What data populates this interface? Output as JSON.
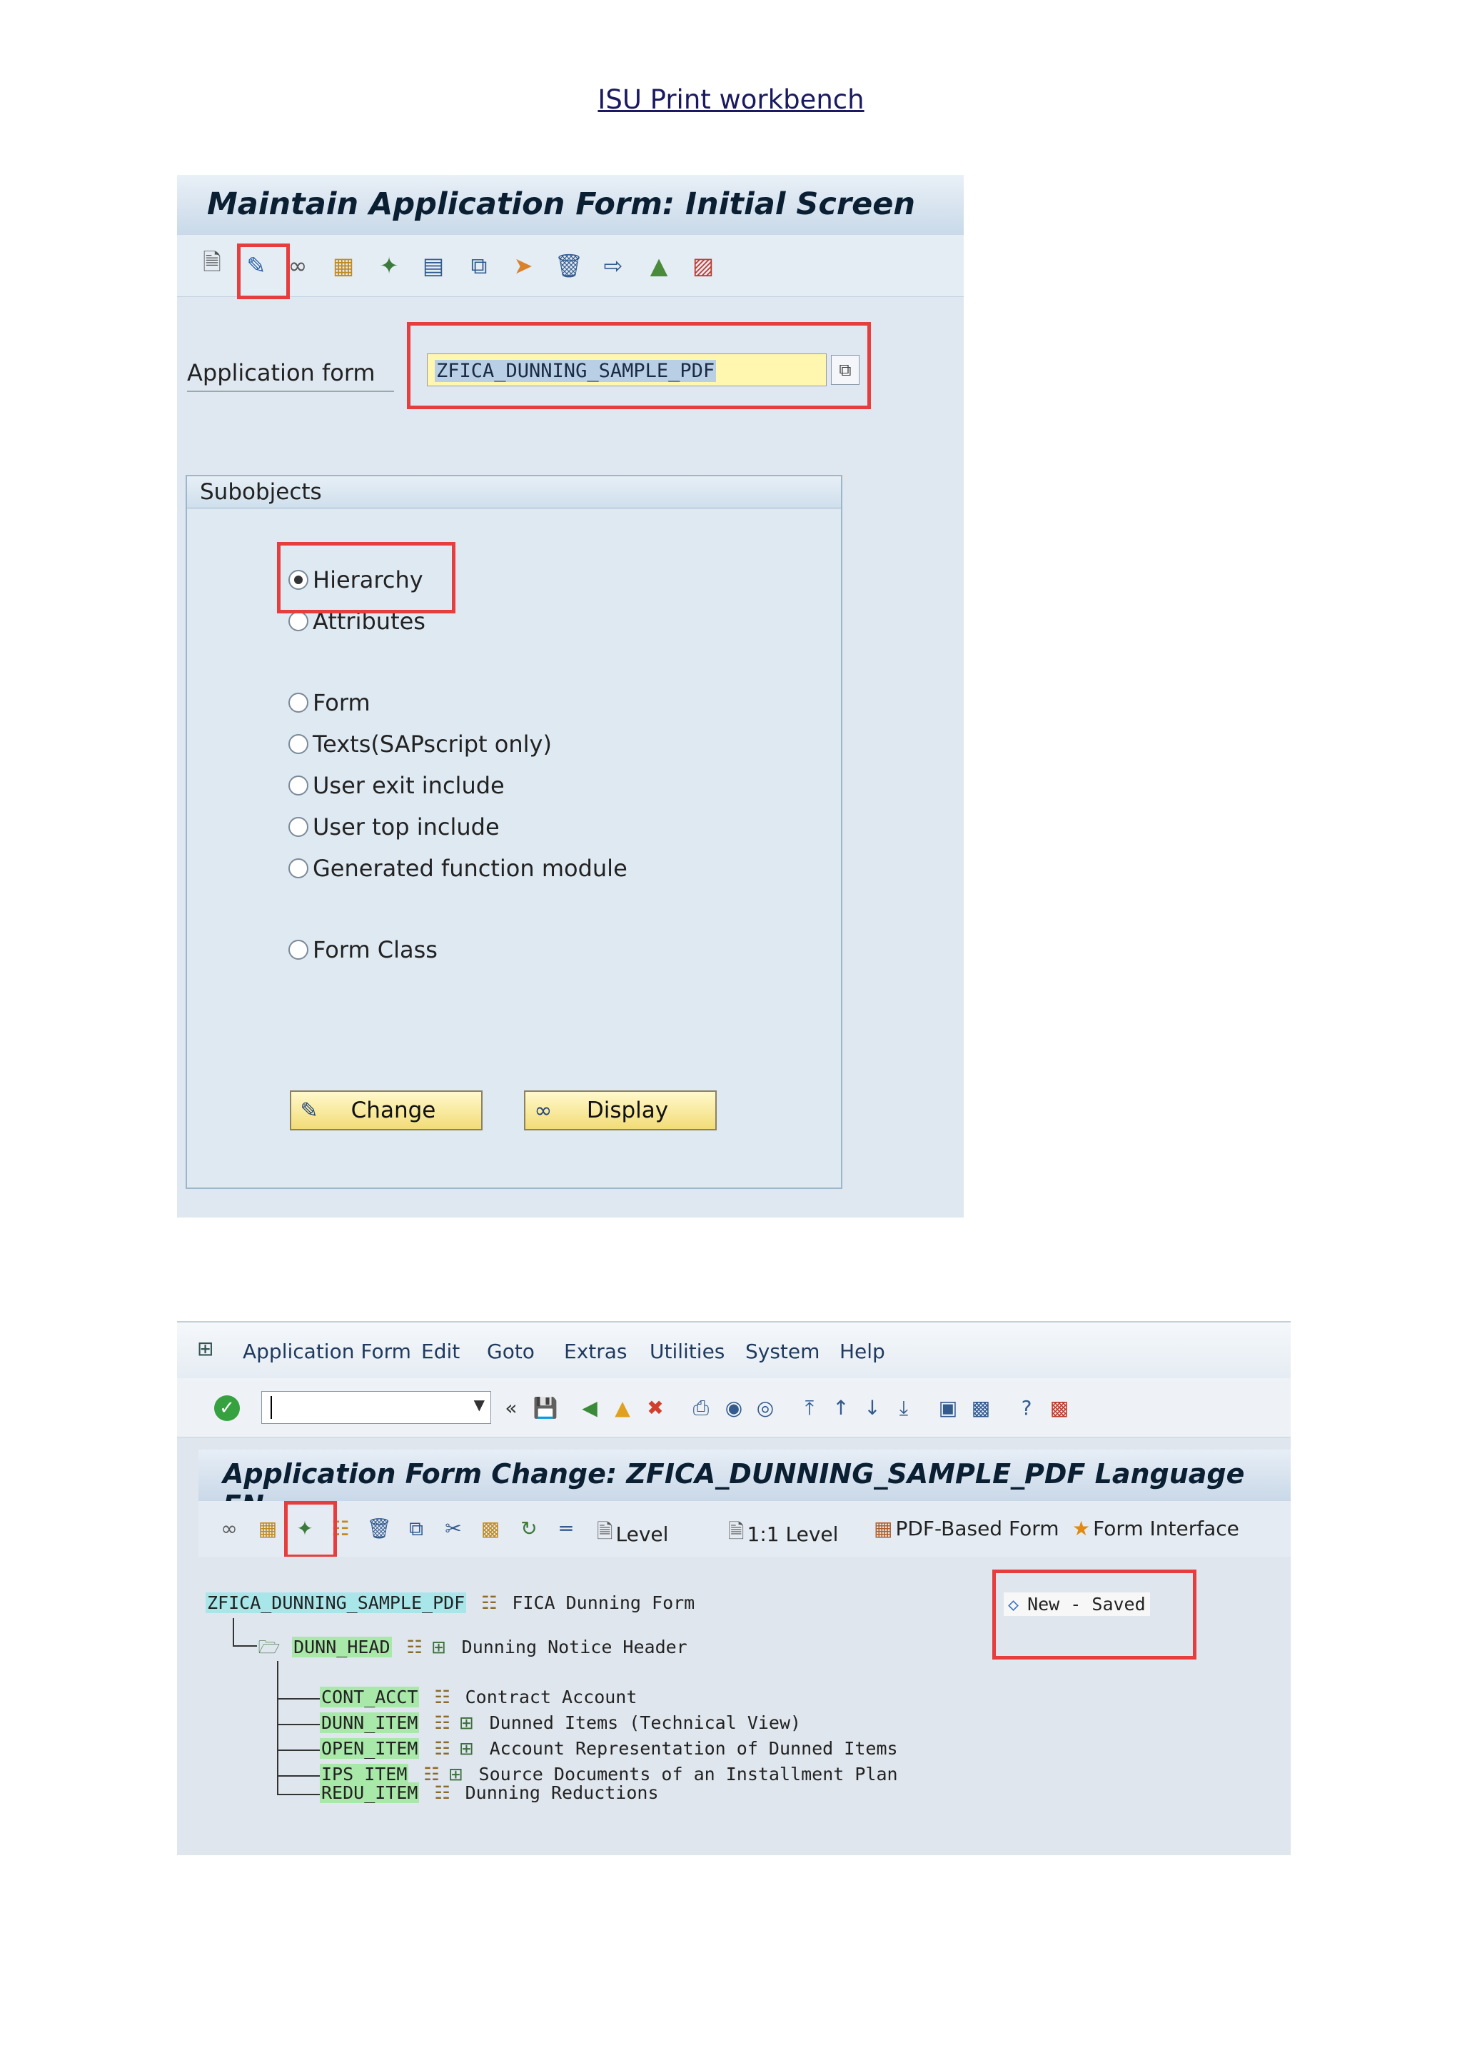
{
  "doc": {
    "heading": "ISU Print workbench"
  },
  "screen1": {
    "title": "Maintain Application Form: Initial Screen",
    "toolbar_icons": [
      "create-icon",
      "change-pencil-icon",
      "display-glasses-icon",
      "hierarchy-icon",
      "magic-wand-icon",
      "form-class-icon",
      "copy-icon",
      "execute-icon",
      "delete-icon",
      "transport-icon",
      "mountain-icon",
      "truck-icon"
    ],
    "application_form_label": "Application form",
    "application_form_value": "ZFICA_DUNNING_SAMPLE_PDF",
    "subobjects_title": "Subobjects",
    "radios": [
      {
        "label": "Hierarchy",
        "checked": true
      },
      {
        "label": "Attributes",
        "checked": false
      },
      {
        "label": "Form",
        "checked": false
      },
      {
        "label": "Texts(SAPscript only)",
        "checked": false
      },
      {
        "label": "User exit include",
        "checked": false
      },
      {
        "label": "User top include",
        "checked": false
      },
      {
        "label": "Generated function module",
        "checked": false
      },
      {
        "label": "Form Class",
        "checked": false
      }
    ],
    "change_button": "Change",
    "display_button": "Display"
  },
  "screen2": {
    "menu": [
      "Application Form",
      "Edit",
      "Goto",
      "Extras",
      "Utilities",
      "System",
      "Help"
    ],
    "title": "Application Form Change: ZFICA_DUNNING_SAMPLE_PDF Language EN",
    "toolbar_labels": {
      "level": "Level",
      "one_to_one_level": "1:1 Level",
      "pdf_based_form": "PDF-Based Form",
      "form_interface": "Form Interface"
    },
    "status": {
      "new": "New",
      "separator": "-",
      "saved": "Saved"
    },
    "tree": {
      "root": {
        "name": "ZFICA_DUNNING_SAMPLE_PDF",
        "desc": "FICA Dunning Form"
      },
      "head": {
        "name": "DUNN_HEAD",
        "desc": "Dunning Notice Header"
      },
      "children": [
        {
          "name": "CONT_ACCT",
          "desc": "Contract Account"
        },
        {
          "name": "DUNN_ITEM",
          "desc": "Dunned Items (Technical View)"
        },
        {
          "name": "OPEN_ITEM",
          "desc": "Account Representation of Dunned Items"
        },
        {
          "name": "IPS_ITEM",
          "desc": "Source Documents of an Installment Plan"
        },
        {
          "name": "REDU_ITEM",
          "desc": "Dunning Reductions"
        }
      ]
    }
  }
}
